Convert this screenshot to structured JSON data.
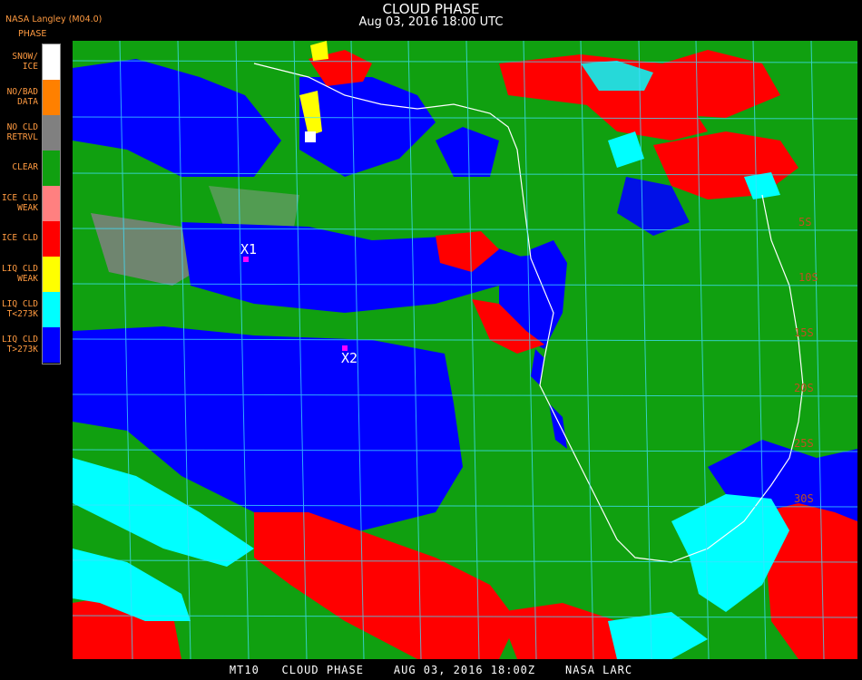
{
  "header": {
    "title": "CLOUD PHASE",
    "subtitle": "Aug 03, 2016 18:00 UTC"
  },
  "org_label": "NASA Langley (M04.0)",
  "legend": {
    "title": "PHASE",
    "items": [
      {
        "label": "SNOW/\nICE",
        "color": "#ffffff"
      },
      {
        "label": "NO/BAD\nDATA",
        "color": "#ff8000"
      },
      {
        "label": "NO CLD\nRETRVL",
        "color": "#808080"
      },
      {
        "label": "CLEAR",
        "color": "#10a010"
      },
      {
        "label": "ICE CLD\nWEAK",
        "color": "#ff8080"
      },
      {
        "label": "ICE CLD",
        "color": "#ff0000"
      },
      {
        "label": "LIQ CLD\nWEAK",
        "color": "#ffff00"
      },
      {
        "label": "LIQ CLD\nT<273K",
        "color": "#00ffff"
      },
      {
        "label": "LIQ CLD\nT>273K",
        "color": "#0000ff"
      }
    ]
  },
  "map": {
    "markers": [
      {
        "label": "X1"
      },
      {
        "label": "X2"
      }
    ],
    "lat_labels": [
      "5S",
      "10S",
      "15S",
      "20S",
      "25S",
      "30S"
    ]
  },
  "footer": "MT10   CLOUD PHASE    AUG 03, 2016 18:00Z    NASA LARC"
}
